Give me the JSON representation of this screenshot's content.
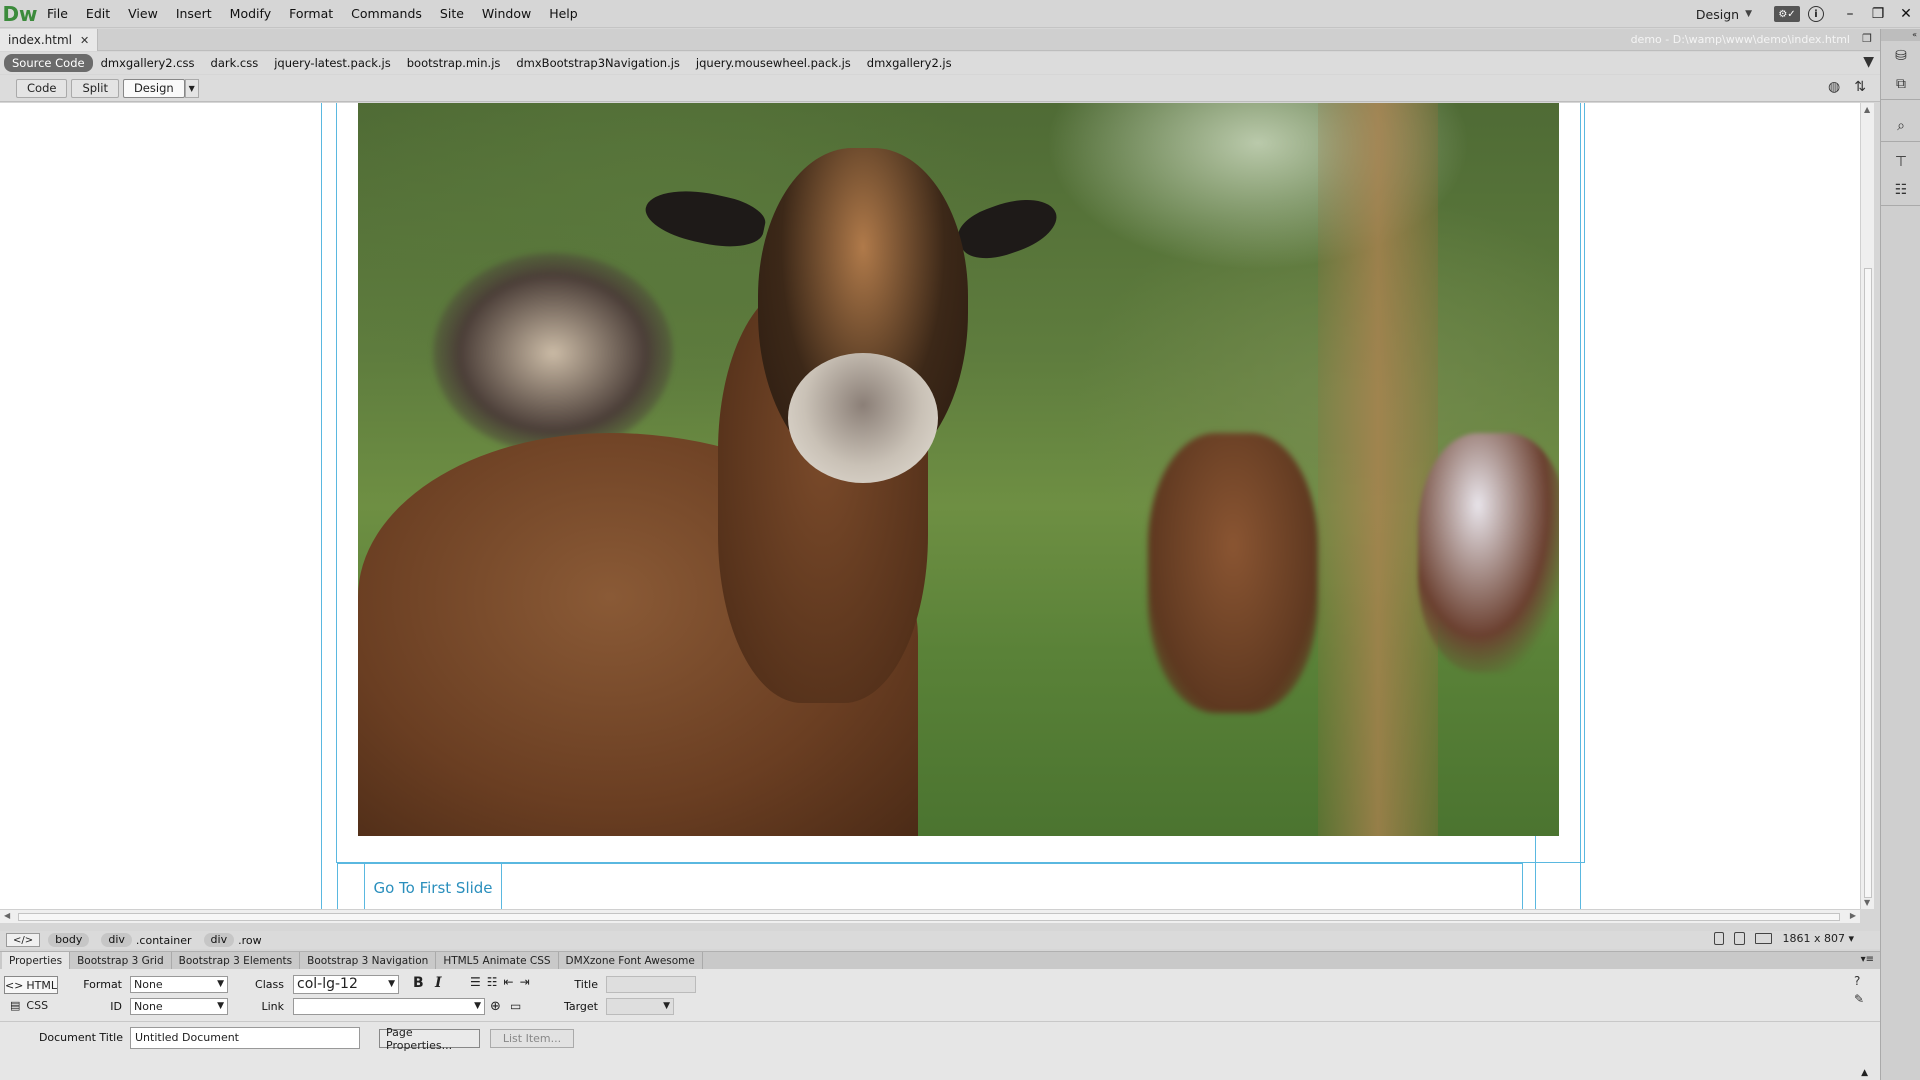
{
  "app": {
    "logo": "Dw"
  },
  "menu": [
    "File",
    "Edit",
    "View",
    "Insert",
    "Modify",
    "Format",
    "Commands",
    "Site",
    "Window",
    "Help"
  ],
  "workspace": {
    "label": "Design"
  },
  "window_controls": {
    "minimize": "–",
    "restore": "❐",
    "close": "✕"
  },
  "document": {
    "tab": "index.html",
    "path": "demo - D:\\wamp\\www\\demo\\index.html"
  },
  "related_files": [
    "Source Code",
    "dmxgallery2.css",
    "dark.css",
    "jquery-latest.pack.js",
    "bootstrap.min.js",
    "dmxBootstrap3Navigation.js",
    "jquery.mousewheel.pack.js",
    "dmxgallery2.js"
  ],
  "view_buttons": {
    "code": "Code",
    "split": "Split",
    "design": "Design"
  },
  "canvas": {
    "go_first": "Go To First Slide"
  },
  "tag_selector": {
    "code_icon": "</>",
    "crumbs": [
      {
        "tag": "body",
        "cls": ""
      },
      {
        "tag": "div",
        "cls": ".container"
      },
      {
        "tag": "div",
        "cls": ".row"
      }
    ],
    "size": "1861 x 807"
  },
  "panel_tabs": [
    "Properties",
    "Bootstrap 3 Grid",
    "Bootstrap 3 Elements",
    "Bootstrap 3 Navigation",
    "HTML5 Animate CSS",
    "DMXzone Font Awesome"
  ],
  "properties": {
    "html_label": "HTML",
    "css_label": "CSS",
    "format_label": "Format",
    "format_value": "None",
    "id_label": "ID",
    "id_value": "None",
    "class_label": "Class",
    "class_value": "col-lg-12",
    "link_label": "Link",
    "link_value": "",
    "bold": "B",
    "italic": "I",
    "title_label": "Title",
    "title_value": "",
    "target_label": "Target",
    "target_value": "",
    "doc_title_label": "Document Title",
    "doc_title_value": "Untitled Document",
    "page_properties": "Page Properties...",
    "list_item": "List Item..."
  }
}
